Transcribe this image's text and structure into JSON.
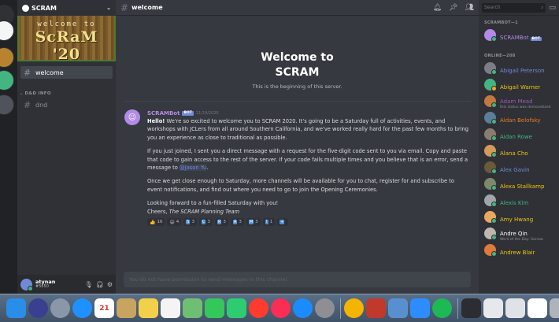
{
  "server": {
    "name": "SCRAM",
    "banner_top": "welcome to",
    "banner_main": "ScRaM '20"
  },
  "sidebar": {
    "channels": [
      {
        "label": "welcome",
        "active": true
      }
    ],
    "category": "D&D INFO",
    "category_channels": [
      {
        "label": "dnd"
      }
    ]
  },
  "user": {
    "name": "atynan",
    "tag": "#5650"
  },
  "topbar": {
    "channel": "welcome",
    "search_placeholder": "Search"
  },
  "welcome": {
    "title_line1": "Welcome to",
    "title_line2": "SCRAM",
    "subtitle": "This is the beginning of this server."
  },
  "message": {
    "author": "SCRAMBot",
    "bot_tag": "BOT",
    "date": "11/19/2020",
    "p1_bold": "Hello!",
    "p1_rest": " We're so excited to welcome you to SCRAM 2020. It's going to be a Saturday full of activities, events, and workshops with JCLers from all around Southern California, and we've worked really hard for the past few months to bring you an experience as close to traditional as possible.",
    "p2": "If you just joined, I sent you a direct message with a request for the five-digit code sent to you via email. Copy and paste that code to gain access to the rest of the server. If your code fails multiple times and you believe that is an error, send a message to ",
    "p2_mention": "@Jason Yu",
    "p2_end": ".",
    "p3": "Once we get close enough to Saturday, more channels will be available for you to chat, register for and subscribe to event notifications, and find out where you need to go to join the Opening Ceremonies.",
    "p4_line1": "Looking forward to a fun-filled Saturday with you!",
    "p4_line2_a": "Cheers, ",
    "p4_line2_b": "The SCRAM Planning Team",
    "reactions": [
      {
        "emoji": "👍",
        "count": "16"
      },
      {
        "emoji": "😄",
        "count": "4"
      },
      {
        "emoji": "S",
        "count": "3"
      },
      {
        "emoji": "C",
        "count": "3"
      },
      {
        "emoji": "R",
        "count": "3"
      },
      {
        "emoji": "A",
        "count": "3"
      },
      {
        "emoji": "M",
        "count": "3"
      },
      {
        "emoji": "!",
        "count": "1"
      },
      {
        "emoji": "+",
        "count": ""
      }
    ]
  },
  "composer": {
    "placeholder": "You do not have permission to send messages in this channel."
  },
  "members": {
    "bot_header": "SCRAMBOT—1",
    "bots": [
      {
        "name": "SCRAMBot",
        "tag": "BOT",
        "color": "#b48ce8",
        "avatar": "#b28be8"
      }
    ],
    "online_header": "ONLINE—208",
    "online": [
      {
        "name": "Abigail Peterson",
        "color": "#7289da",
        "avatar": "#7a7f87",
        "status": "#43b581"
      },
      {
        "name": "Abigail Warner",
        "color": "#f1c40f",
        "avatar": "#43b581",
        "status": "#faa61a"
      },
      {
        "name": "Adam Mead",
        "sub": "this status was demonetized",
        "color": "#9b59b6",
        "avatar": "#c2783f",
        "status": "#43b581"
      },
      {
        "name": "Aidan Belofsky",
        "color": "#e67e22",
        "avatar": "#5b7f9a",
        "status": "#43b581"
      },
      {
        "name": "Aidan Rowe",
        "color": "#43b581",
        "avatar": "#8a7d6e",
        "status": "#43b581"
      },
      {
        "name": "Alana Cho",
        "color": "#f1c40f",
        "avatar": "#d39a5a",
        "status": "#43b581"
      },
      {
        "name": "Alex Gavin",
        "color": "#7289da",
        "avatar": "#6a5a3a",
        "status": "#43b581"
      },
      {
        "name": "Alexa Stallkamp",
        "color": "#f1c40f",
        "avatar": "#7c8a6a",
        "status": "#43b581"
      },
      {
        "name": "Alexis Kim",
        "color": "#43b581",
        "avatar": "#a0a4ab",
        "status": "#43b581"
      },
      {
        "name": "Amy Hwang",
        "color": "#f1c40f",
        "avatar": "#e8a860",
        "status": "#43b581"
      },
      {
        "name": "Andre Qin",
        "sub": "Word of the Day: Sorrow",
        "color": "#ffffff",
        "avatar": "#bfb6ad",
        "status": "#43b581"
      },
      {
        "name": "Andrew Blair",
        "color": "#f1c40f",
        "avatar": "#e07a3a",
        "status": "#43b581"
      }
    ]
  },
  "dock": {
    "apps": [
      {
        "icon": "finder-icon",
        "color": "#2a8de8"
      },
      {
        "icon": "siri-icon",
        "color": "#3b3f8f",
        "round": true
      },
      {
        "icon": "launchpad-icon",
        "color": "#8a97a8",
        "round": true
      },
      {
        "icon": "safari-icon",
        "color": "#1e90ff",
        "round": true
      },
      {
        "icon": "calendar-icon",
        "color": "#ffffff",
        "label": "21"
      },
      {
        "icon": "notes-icon",
        "color": "#c8a460"
      },
      {
        "icon": "stickies-icon",
        "color": "#f2d04a"
      },
      {
        "icon": "reminders-icon",
        "color": "#f4f4f4"
      },
      {
        "icon": "photos-icon",
        "color": "#6fbf73"
      },
      {
        "icon": "messages-icon",
        "color": "#34c759"
      },
      {
        "icon": "facetime-icon",
        "color": "#2ecc71"
      },
      {
        "icon": "news-icon",
        "color": "#ff3b30",
        "round": true
      },
      {
        "icon": "music-icon",
        "color": "#fa2d55",
        "round": true
      },
      {
        "icon": "appstore-icon",
        "color": "#1a8cff",
        "round": true
      },
      {
        "icon": "settings-icon",
        "color": "#8e8e93",
        "round": true
      },
      {
        "icon": "chrome-icon",
        "color": "#f4b400",
        "round": true
      },
      {
        "icon": "photobooth-icon",
        "color": "#c0392b"
      },
      {
        "icon": "preview-icon",
        "color": "#5a8fcf"
      },
      {
        "icon": "zoom-icon",
        "color": "#2d8cff"
      },
      {
        "icon": "spotify-icon",
        "color": "#1db954",
        "round": true
      },
      {
        "icon": "window-thumb-1-icon",
        "color": "#2b2d33"
      },
      {
        "icon": "window-thumb-2-icon",
        "color": "#e6e8ec"
      },
      {
        "icon": "window-thumb-3-icon",
        "color": "#dfe3e8"
      },
      {
        "icon": "window-thumb-4-icon",
        "color": "#ffffff"
      },
      {
        "icon": "trash-icon",
        "color": "#aeb4bc"
      }
    ]
  }
}
